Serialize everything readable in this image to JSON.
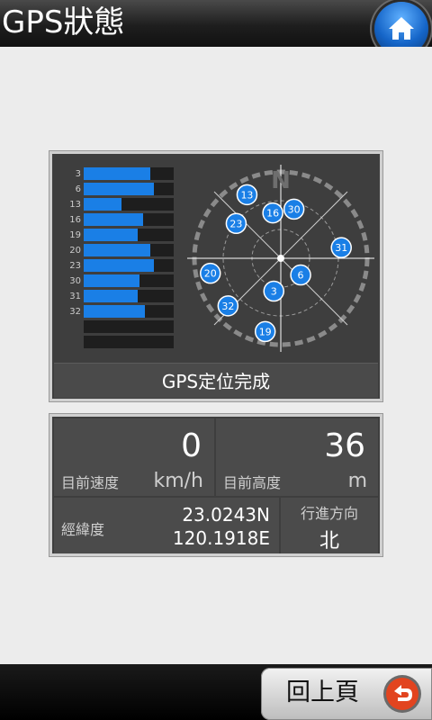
{
  "header": {
    "title": "GPS狀態"
  },
  "satellites": {
    "bars": [
      {
        "id": "3",
        "strength": 0.74
      },
      {
        "id": "6",
        "strength": 0.78
      },
      {
        "id": "13",
        "strength": 0.42
      },
      {
        "id": "16",
        "strength": 0.66
      },
      {
        "id": "19",
        "strength": 0.6
      },
      {
        "id": "20",
        "strength": 0.74
      },
      {
        "id": "23",
        "strength": 0.78
      },
      {
        "id": "30",
        "strength": 0.62
      },
      {
        "id": "31",
        "strength": 0.6
      },
      {
        "id": "32",
        "strength": 0.68
      },
      {
        "id": "",
        "strength": 0
      },
      {
        "id": "",
        "strength": 0
      }
    ],
    "compass_label": "N",
    "sky": [
      {
        "id": "13",
        "az": 332,
        "el": 15
      },
      {
        "id": "16",
        "az": 350,
        "el": 42
      },
      {
        "id": "30",
        "az": 15,
        "el": 37
      },
      {
        "id": "23",
        "az": 308,
        "el": 31
      },
      {
        "id": "31",
        "az": 80,
        "el": 26
      },
      {
        "id": "20",
        "az": 258,
        "el": 15
      },
      {
        "id": "6",
        "az": 130,
        "el": 63
      },
      {
        "id": "3",
        "az": 192,
        "el": 55
      },
      {
        "id": "32",
        "az": 228,
        "el": 16
      },
      {
        "id": "19",
        "az": 192,
        "el": 12
      }
    ]
  },
  "status": {
    "text": "GPS定位完成"
  },
  "speed": {
    "value": "0",
    "label": "目前速度",
    "unit": "km/h"
  },
  "altitude": {
    "value": "36",
    "label": "目前高度",
    "unit": "m"
  },
  "position": {
    "label": "經緯度",
    "lat": "23.0243N",
    "lon": "120.1918E"
  },
  "heading": {
    "label": "行進方向",
    "value": "北"
  },
  "footer": {
    "back_label": "回上頁"
  },
  "colors": {
    "accent": "#1a7fe6",
    "panel": "#3e3e3e",
    "back_icon": "#e2441f"
  }
}
